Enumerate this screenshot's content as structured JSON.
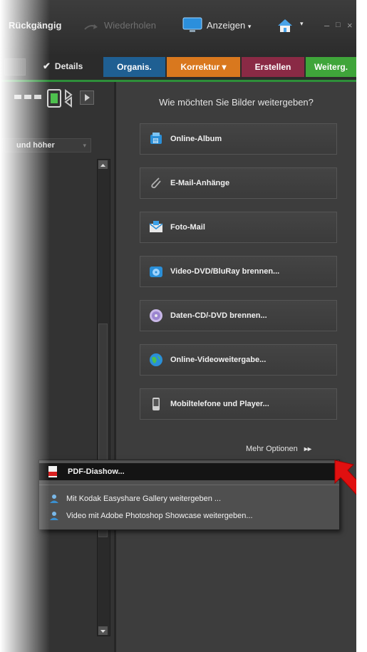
{
  "toolbar": {
    "undo_label": "Rückgängig",
    "redo_label": "Wiederholen",
    "view_label": "Anzeigen",
    "view_caret": "▾",
    "home_caret": "▾",
    "minimize": "–",
    "maximize": "□",
    "close": "×"
  },
  "tabs": {
    "details_label": "Details",
    "items": [
      {
        "label": "Organis.",
        "color": "#1f5f92"
      },
      {
        "label": "Korrektur ▾",
        "color": "#d9781e"
      },
      {
        "label": "Erstellen",
        "color": "#8a2a45"
      },
      {
        "label": "Weiterg.",
        "color": "#3fa53a"
      }
    ]
  },
  "left_panel": {
    "filter_value": "und höher",
    "filter_caret": "▾"
  },
  "share": {
    "heading": "Wie möchten Sie Bilder weitergeben?",
    "options": [
      {
        "label": "Online-Album",
        "icon": "online-album-icon"
      },
      {
        "label": "E-Mail-Anhänge",
        "icon": "paperclip-icon"
      },
      {
        "label": "Foto-Mail",
        "icon": "photo-mail-icon"
      },
      {
        "label": "Video-DVD/BluRay brennen...",
        "icon": "video-disc-icon"
      },
      {
        "label": "Daten-CD/-DVD brennen...",
        "icon": "data-disc-icon"
      },
      {
        "label": "Online-Videoweitergabe...",
        "icon": "globe-icon"
      },
      {
        "label": "Mobiltelefone und Player...",
        "icon": "mobile-phone-icon"
      }
    ],
    "more_options_label": "Mehr Optionen",
    "more_options_arrows": "▸▸"
  },
  "popup_menu": {
    "items": [
      {
        "label": "PDF-Diashow...",
        "highlighted": true
      },
      {
        "label": "Mit Kodak Easyshare Gallery weitergeben ..."
      },
      {
        "label": "Video mit Adobe Photoshop Showcase weitergeben..."
      }
    ]
  },
  "colors": {
    "accent_green": "#2e8f3a",
    "annotation_arrow": "#e01010"
  }
}
